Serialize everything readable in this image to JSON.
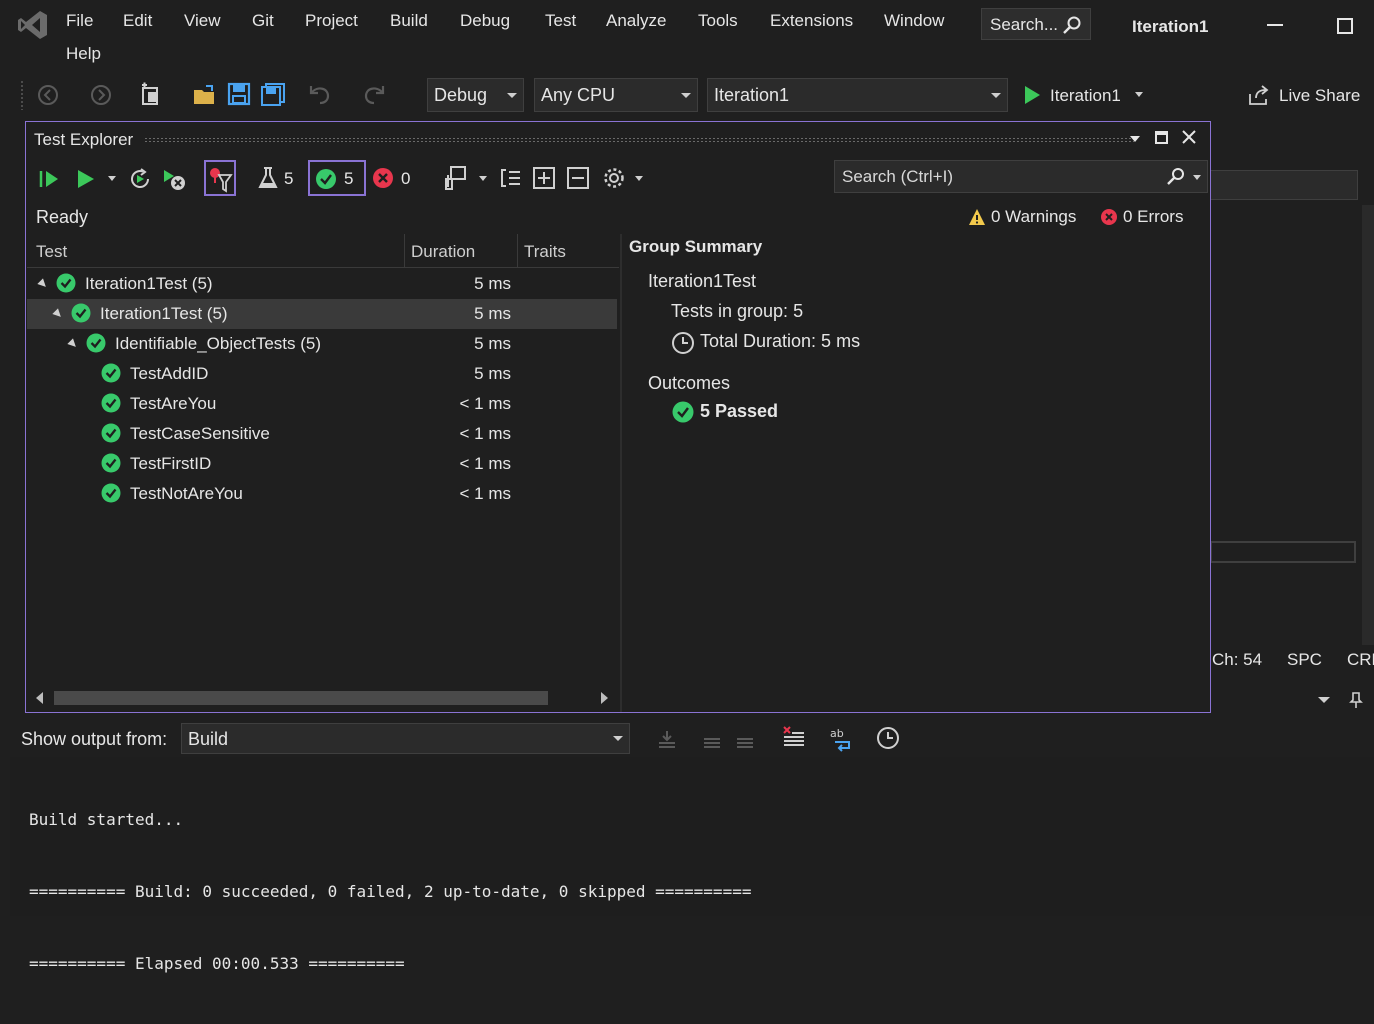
{
  "menu": {
    "items": [
      "File",
      "Edit",
      "View",
      "Git",
      "Project",
      "Build",
      "Debug",
      "Test",
      "Analyze",
      "Tools",
      "Extensions",
      "Window",
      "Help"
    ],
    "search_label": "Search...",
    "solution_name": "Iteration1"
  },
  "toolbar": {
    "config_value": "Debug",
    "platform_value": "Any CPU",
    "startup_project": "Iteration1",
    "run_label": "Iteration1",
    "live_share_label": "Live Share"
  },
  "test_explorer": {
    "title": "Test Explorer",
    "total_tests": "5",
    "passed_count": "5",
    "failed_count": "0",
    "search_placeholder": "Search (Ctrl+I)",
    "status": "Ready",
    "warnings_label": "0 Warnings",
    "errors_label": "0 Errors",
    "columns": {
      "test": "Test",
      "duration": "Duration",
      "traits": "Traits"
    },
    "rows": [
      {
        "name": "Iteration1Test  (5)",
        "duration": "5 ms"
      },
      {
        "name": "Iteration1Test  (5)",
        "duration": "5 ms"
      },
      {
        "name": "Identifiable_ObjectTests  (5)",
        "duration": "5 ms"
      },
      {
        "name": "TestAddID",
        "duration": "5 ms"
      },
      {
        "name": "TestAreYou",
        "duration": "< 1 ms"
      },
      {
        "name": "TestCaseSensitive",
        "duration": "< 1 ms"
      },
      {
        "name": "TestFirstID",
        "duration": "< 1 ms"
      },
      {
        "name": "TestNotAreYou",
        "duration": "< 1 ms"
      }
    ],
    "summary": {
      "heading": "Group Summary",
      "group_name": "Iteration1Test",
      "tests_in_group": "Tests in group: 5",
      "total_duration": "Total Duration: 5 ms",
      "outcomes_label": "Outcomes",
      "passed_label": "5 Passed"
    }
  },
  "status_bar": {
    "ch": "Ch: 54",
    "spc": "SPC",
    "crlf": "CRL"
  },
  "output": {
    "show_from_label": "Show output from:",
    "source_value": "Build",
    "lines": [
      "Build started...",
      "========== Build: 0 succeeded, 0 failed, 2 up-to-date, 0 skipped ==========",
      "========== Elapsed 00:00.533 =========="
    ]
  },
  "colors": {
    "accent": "#8a73d4",
    "pass": "#38c96b",
    "fail": "#e8364d",
    "run": "#3cc85a"
  }
}
